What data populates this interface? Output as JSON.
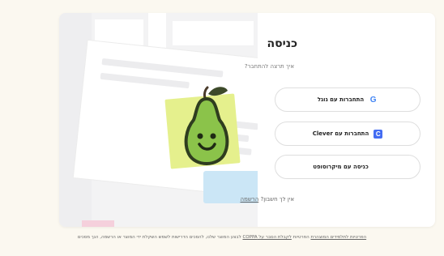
{
  "login": {
    "title": "כניסה",
    "subtitle": "איך תרצה להתחבר?",
    "google_label": "התחברות עם גוגל",
    "clever_label": "התחברות עם Clever",
    "microsoft_label": "כניסה עם מיקרוסופט",
    "no_account": "הרשמה",
    "no_account_question": "אין לך חשבון?"
  },
  "icons": {
    "google": "google-icon",
    "clever": "clever-icon",
    "microsoft": "microsoft-icon",
    "pear": "pear-icon"
  },
  "footer": {
    "part1": "הפרטיות לתלמידים המוצהרת",
    "part2": "הפרטיות",
    "coppa": "לקבלת הסבר על COPPA",
    "part3": "לקבלת הנחיות של COPPA",
    "part4": "לבצע המוצר שלנו, להסכים הדרישות לשמש",
    "part5": "השקלת ידי המוצר או הרשמה, הנך מסכים"
  },
  "colors": {
    "background": "#fbf8f0",
    "lime": "#e5f08d",
    "pear_green": "#8bc34a",
    "clever_blue": "#436cf2"
  }
}
